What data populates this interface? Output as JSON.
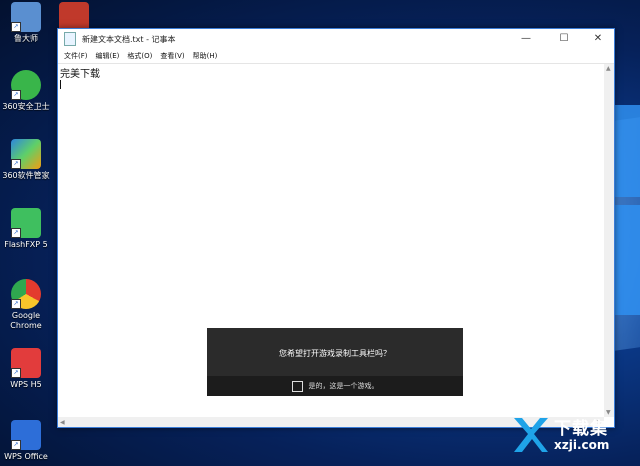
{
  "desktop": {
    "icons": [
      {
        "label": "鲁大师",
        "color": "#5a8fd0"
      },
      {
        "label": "",
        "color": "#c0392b"
      },
      {
        "label": "360安全卫士",
        "color": "#39b54a"
      },
      {
        "label": "360软件管家",
        "color": "#2e86de"
      },
      {
        "label": "FlashFXP 5",
        "color": "#3fbf5f"
      },
      {
        "label": "Google Chrome",
        "color": "#e33b2e"
      },
      {
        "label": "WPS H5",
        "color": "#e23c3c"
      },
      {
        "label": "WPS Office",
        "color": "#2d6ed8"
      }
    ]
  },
  "notepad": {
    "title": "新建文本文档.txt - 记事本",
    "menu": [
      "文件(F)",
      "编辑(E)",
      "格式(O)",
      "查看(V)",
      "帮助(H)"
    ],
    "content": "完美下载",
    "controls": {
      "minimize": "—",
      "maximize": "☐",
      "close": "✕"
    }
  },
  "gamebar": {
    "question": "您希望打开游戏录制工具栏吗？",
    "checkbox_label": "是的，这是一个游戏。"
  },
  "watermark": {
    "cn": "下载集",
    "en": "xzji.com"
  }
}
